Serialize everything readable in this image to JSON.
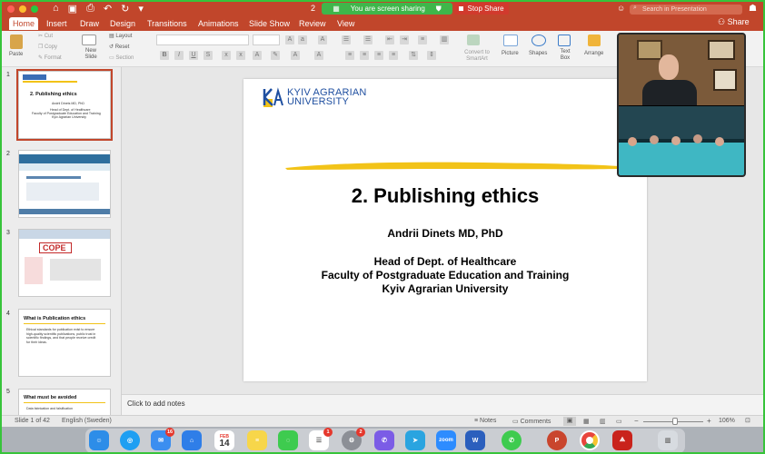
{
  "window": {
    "title_short": "2",
    "screen_sharing": "You are screen sharing",
    "stop_share": "Stop Share",
    "search_placeholder": "Search in Presentation",
    "share_label": "Share"
  },
  "tabs": [
    "Home",
    "Insert",
    "Draw",
    "Design",
    "Transitions",
    "Animations",
    "Slide Show",
    "Review",
    "View"
  ],
  "ribbon": {
    "paste": "Paste",
    "cut": "Cut",
    "copy": "Copy",
    "format": "Format",
    "new_slide": "New Slide",
    "layout": "Layout",
    "reset": "Reset",
    "section": "Section",
    "convert_smartart": "Convert to SmartArt",
    "picture": "Picture",
    "shapes": "Shapes",
    "text_box": "Text Box",
    "arrange": "Arrange"
  },
  "thumbnails": [
    {
      "num": "1",
      "title": "2. Publishing ethics",
      "line1": "Andrii Dinets MD, PhD",
      "line2": "Head of Dept. of Healthcare",
      "line3": "Faculty of Postgraduate Education and Training",
      "line4": "Kyiv Agrarian University"
    },
    {
      "num": "2"
    },
    {
      "num": "3",
      "title": "COPE"
    },
    {
      "num": "4",
      "title": "What is Publication ethics",
      "body": "Ethical standards for publication exist to ensure high-quality scientific publications, public trust in scientific findings, and that people receive credit for their ideas."
    },
    {
      "num": "5",
      "title": "What must be avoided",
      "body": "Data fabrication and falsification"
    }
  ],
  "slide": {
    "university_line1": "KYIV AGRARIAN",
    "university_line2": "UNIVERSITY",
    "title": "2. Publishing ethics",
    "author": "Andrii Dinets MD, PhD",
    "position": "Head of Dept. of Healthcare",
    "faculty": "Faculty of Postgraduate Education and Training",
    "university": "Kyiv Agrarian University"
  },
  "notes_placeholder": "Click to add notes",
  "status": {
    "slide_counter": "Slide 1 of 42",
    "language": "English (Sweden)",
    "notes": "Notes",
    "comments": "Comments",
    "zoom": "106%"
  },
  "dock": {
    "calendar_month": "FEB",
    "calendar_day": "14",
    "mail_badge": "16",
    "reminders_badge": "1",
    "settings_badge": "2",
    "zoom_label": "zoom"
  },
  "colors": {
    "ribbon_accent": "#c1462b",
    "share_green": "#3fb64a",
    "stop_red": "#d13a2d",
    "university_blue": "#1f4fa0",
    "highlight_yellow": "#f2c318"
  }
}
